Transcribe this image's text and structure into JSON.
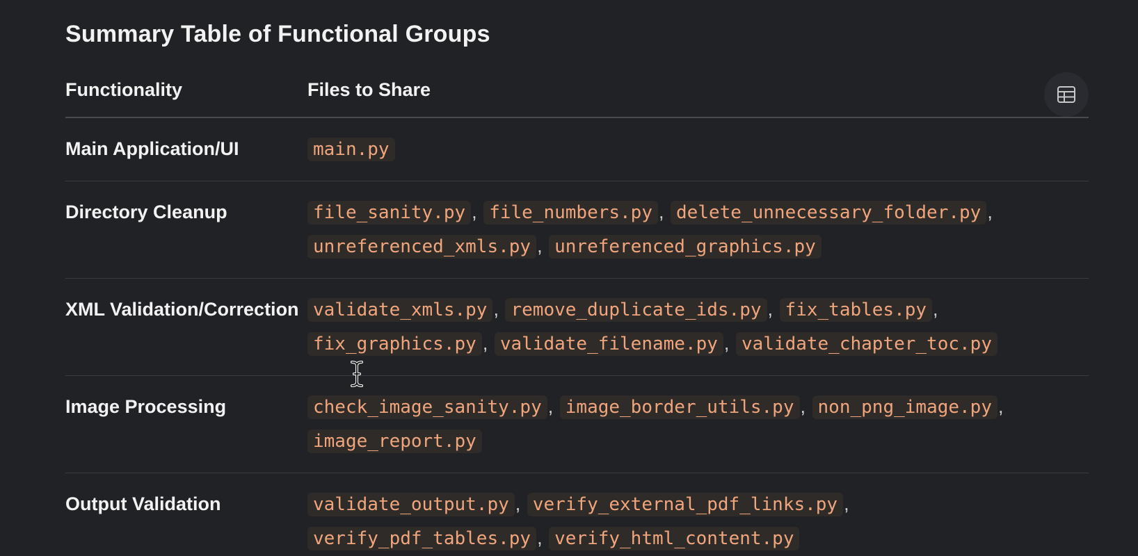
{
  "section": {
    "heading": "Summary Table of Functional Groups"
  },
  "table": {
    "headers": {
      "functionality": "Functionality",
      "files": "Files to Share"
    },
    "rows": [
      {
        "functionality": "Main Application/UI",
        "files": [
          "main.py"
        ],
        "line_breaks_after": []
      },
      {
        "functionality": "Directory Cleanup",
        "files": [
          "file_sanity.py",
          "file_numbers.py",
          "delete_unnecessary_folder.py",
          "unreferenced_xmls.py",
          "unreferenced_graphics.py"
        ],
        "line_breaks_after": [
          2
        ]
      },
      {
        "functionality": "XML Validation/Correction",
        "files": [
          "validate_xmls.py",
          "remove_duplicate_ids.py",
          "fix_tables.py",
          "fix_graphics.py",
          "validate_filename.py",
          "validate_chapter_toc.py"
        ],
        "line_breaks_after": [
          2
        ]
      },
      {
        "functionality": "Image Processing",
        "files": [
          "check_image_sanity.py",
          "image_border_utils.py",
          "non_png_image.py",
          "image_report.py"
        ],
        "line_breaks_after": [
          2
        ]
      },
      {
        "functionality": "Output Validation",
        "files": [
          "validate_output.py",
          "verify_external_pdf_links.py",
          "verify_pdf_tables.py",
          "verify_html_content.py"
        ],
        "line_breaks_after": [
          1
        ]
      }
    ],
    "separator": ","
  },
  "toolbar": {
    "table_view_icon": "table-grid-icon"
  },
  "colors": {
    "background": "#212226",
    "code_text": "#f0a57c",
    "code_bg": "#2f2b29",
    "divider": "#3b3c41"
  }
}
